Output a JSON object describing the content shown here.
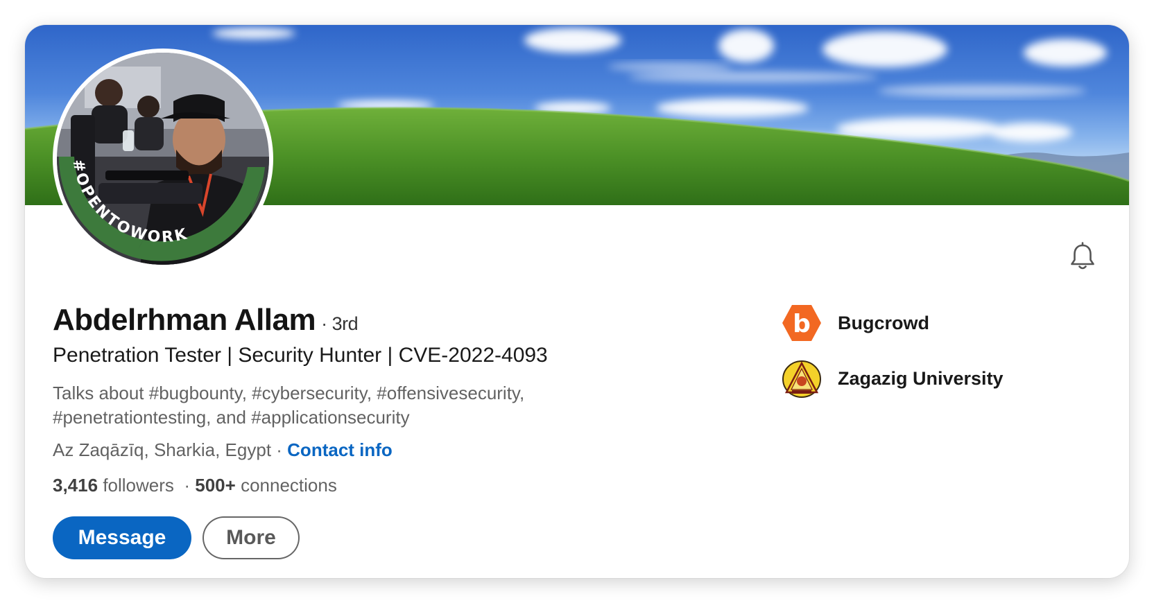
{
  "profile": {
    "name": "Abdelrhman Allam",
    "degree": "· 3rd",
    "headline": "Penetration Tester | Security Hunter | CVE-2022-4093",
    "talks_line1": "Talks about #bugbounty, #cybersecurity, #offensivesecurity,",
    "talks_line2": "#penetrationtesting, and #applicationsecurity",
    "location": "Az Zaqāzīq, Sharkia, Egypt",
    "location_sep": " · ",
    "contact_info": "Contact info",
    "followers_count": "3,416",
    "followers_label": "followers",
    "stats_sep": "  · ",
    "connections_count": "500+",
    "connections_label": "connections",
    "open_to_work": "#OPENTOWORK"
  },
  "actions": {
    "message_label": "Message",
    "more_label": "More"
  },
  "orgs": [
    {
      "name": "Bugcrowd",
      "icon": "bugcrowd-logo"
    },
    {
      "name": "Zagazig University",
      "icon": "zagazig-university-seal"
    }
  ],
  "icons": {
    "notification": "bell-icon"
  },
  "colors": {
    "primary": "#0a66c2",
    "opentowork_green": "#3d7a3c",
    "bugcrowd_orange": "#f26822"
  }
}
